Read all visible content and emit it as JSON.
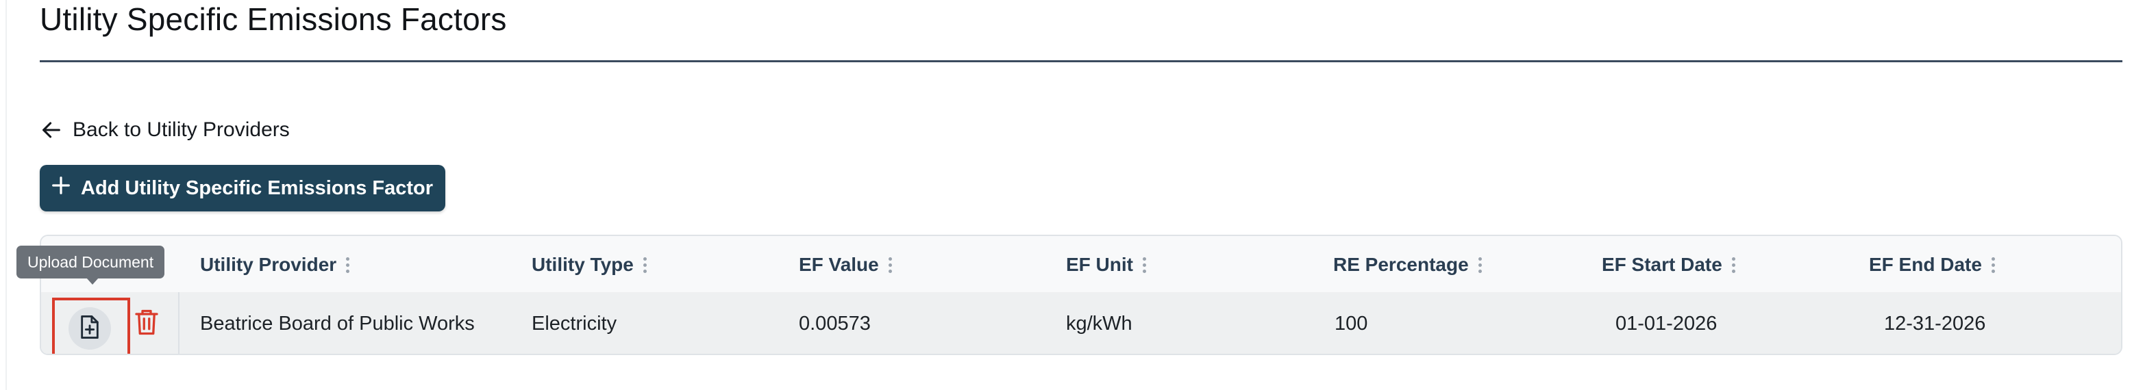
{
  "page": {
    "title": "Utility Specific Emissions Factors"
  },
  "nav": {
    "back_label": "Back to Utility Providers",
    "back_icon": "arrow-left-icon"
  },
  "toolbar": {
    "add_label": "Add Utility Specific Emissions Factor",
    "add_icon": "plus-icon"
  },
  "tooltip": {
    "text": "Upload Document"
  },
  "table": {
    "columns": [
      "Utility Provider",
      "Utility Type",
      "EF Value",
      "EF Unit",
      "RE Percentage",
      "EF Start Date",
      "EF End Date"
    ],
    "rows": [
      {
        "utility_provider": "Beatrice Board of Public Works",
        "utility_type": "Electricity",
        "ef_value": "0.00573",
        "ef_unit": "kg/kWh",
        "re_percentage": "100",
        "ef_start_date": "01-01-2026",
        "ef_end_date": "12-31-2026",
        "actions": [
          "upload-document-icon",
          "trash-icon"
        ]
      }
    ]
  },
  "colors": {
    "primary": "#1f4459",
    "header_text": "#2a3e52",
    "danger": "#d93b2b",
    "highlight_border": "#d93b2b",
    "tooltip_bg": "#6b7178"
  }
}
